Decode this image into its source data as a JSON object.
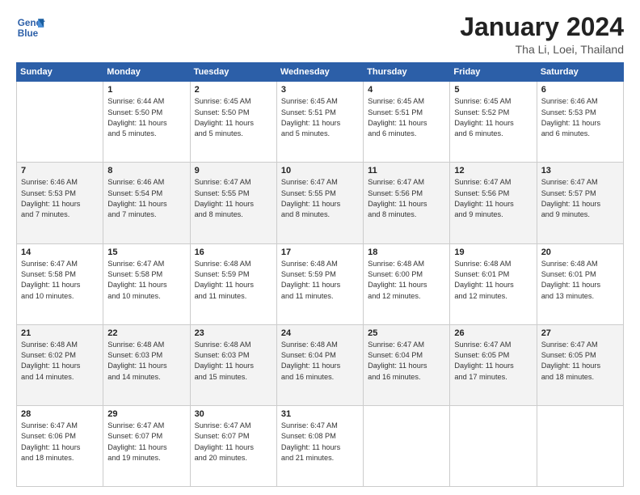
{
  "header": {
    "logo_line1": "General",
    "logo_line2": "Blue",
    "month": "January 2024",
    "location": "Tha Li, Loei, Thailand"
  },
  "weekdays": [
    "Sunday",
    "Monday",
    "Tuesday",
    "Wednesday",
    "Thursday",
    "Friday",
    "Saturday"
  ],
  "weeks": [
    [
      {
        "day": "",
        "info": ""
      },
      {
        "day": "1",
        "info": "Sunrise: 6:44 AM\nSunset: 5:50 PM\nDaylight: 11 hours\nand 5 minutes."
      },
      {
        "day": "2",
        "info": "Sunrise: 6:45 AM\nSunset: 5:50 PM\nDaylight: 11 hours\nand 5 minutes."
      },
      {
        "day": "3",
        "info": "Sunrise: 6:45 AM\nSunset: 5:51 PM\nDaylight: 11 hours\nand 5 minutes."
      },
      {
        "day": "4",
        "info": "Sunrise: 6:45 AM\nSunset: 5:51 PM\nDaylight: 11 hours\nand 6 minutes."
      },
      {
        "day": "5",
        "info": "Sunrise: 6:45 AM\nSunset: 5:52 PM\nDaylight: 11 hours\nand 6 minutes."
      },
      {
        "day": "6",
        "info": "Sunrise: 6:46 AM\nSunset: 5:53 PM\nDaylight: 11 hours\nand 6 minutes."
      }
    ],
    [
      {
        "day": "7",
        "info": "Sunrise: 6:46 AM\nSunset: 5:53 PM\nDaylight: 11 hours\nand 7 minutes."
      },
      {
        "day": "8",
        "info": "Sunrise: 6:46 AM\nSunset: 5:54 PM\nDaylight: 11 hours\nand 7 minutes."
      },
      {
        "day": "9",
        "info": "Sunrise: 6:47 AM\nSunset: 5:55 PM\nDaylight: 11 hours\nand 8 minutes."
      },
      {
        "day": "10",
        "info": "Sunrise: 6:47 AM\nSunset: 5:55 PM\nDaylight: 11 hours\nand 8 minutes."
      },
      {
        "day": "11",
        "info": "Sunrise: 6:47 AM\nSunset: 5:56 PM\nDaylight: 11 hours\nand 8 minutes."
      },
      {
        "day": "12",
        "info": "Sunrise: 6:47 AM\nSunset: 5:56 PM\nDaylight: 11 hours\nand 9 minutes."
      },
      {
        "day": "13",
        "info": "Sunrise: 6:47 AM\nSunset: 5:57 PM\nDaylight: 11 hours\nand 9 minutes."
      }
    ],
    [
      {
        "day": "14",
        "info": "Sunrise: 6:47 AM\nSunset: 5:58 PM\nDaylight: 11 hours\nand 10 minutes."
      },
      {
        "day": "15",
        "info": "Sunrise: 6:47 AM\nSunset: 5:58 PM\nDaylight: 11 hours\nand 10 minutes."
      },
      {
        "day": "16",
        "info": "Sunrise: 6:48 AM\nSunset: 5:59 PM\nDaylight: 11 hours\nand 11 minutes."
      },
      {
        "day": "17",
        "info": "Sunrise: 6:48 AM\nSunset: 5:59 PM\nDaylight: 11 hours\nand 11 minutes."
      },
      {
        "day": "18",
        "info": "Sunrise: 6:48 AM\nSunset: 6:00 PM\nDaylight: 11 hours\nand 12 minutes."
      },
      {
        "day": "19",
        "info": "Sunrise: 6:48 AM\nSunset: 6:01 PM\nDaylight: 11 hours\nand 12 minutes."
      },
      {
        "day": "20",
        "info": "Sunrise: 6:48 AM\nSunset: 6:01 PM\nDaylight: 11 hours\nand 13 minutes."
      }
    ],
    [
      {
        "day": "21",
        "info": "Sunrise: 6:48 AM\nSunset: 6:02 PM\nDaylight: 11 hours\nand 14 minutes."
      },
      {
        "day": "22",
        "info": "Sunrise: 6:48 AM\nSunset: 6:03 PM\nDaylight: 11 hours\nand 14 minutes."
      },
      {
        "day": "23",
        "info": "Sunrise: 6:48 AM\nSunset: 6:03 PM\nDaylight: 11 hours\nand 15 minutes."
      },
      {
        "day": "24",
        "info": "Sunrise: 6:48 AM\nSunset: 6:04 PM\nDaylight: 11 hours\nand 16 minutes."
      },
      {
        "day": "25",
        "info": "Sunrise: 6:47 AM\nSunset: 6:04 PM\nDaylight: 11 hours\nand 16 minutes."
      },
      {
        "day": "26",
        "info": "Sunrise: 6:47 AM\nSunset: 6:05 PM\nDaylight: 11 hours\nand 17 minutes."
      },
      {
        "day": "27",
        "info": "Sunrise: 6:47 AM\nSunset: 6:05 PM\nDaylight: 11 hours\nand 18 minutes."
      }
    ],
    [
      {
        "day": "28",
        "info": "Sunrise: 6:47 AM\nSunset: 6:06 PM\nDaylight: 11 hours\nand 18 minutes."
      },
      {
        "day": "29",
        "info": "Sunrise: 6:47 AM\nSunset: 6:07 PM\nDaylight: 11 hours\nand 19 minutes."
      },
      {
        "day": "30",
        "info": "Sunrise: 6:47 AM\nSunset: 6:07 PM\nDaylight: 11 hours\nand 20 minutes."
      },
      {
        "day": "31",
        "info": "Sunrise: 6:47 AM\nSunset: 6:08 PM\nDaylight: 11 hours\nand 21 minutes."
      },
      {
        "day": "",
        "info": ""
      },
      {
        "day": "",
        "info": ""
      },
      {
        "day": "",
        "info": ""
      }
    ]
  ]
}
